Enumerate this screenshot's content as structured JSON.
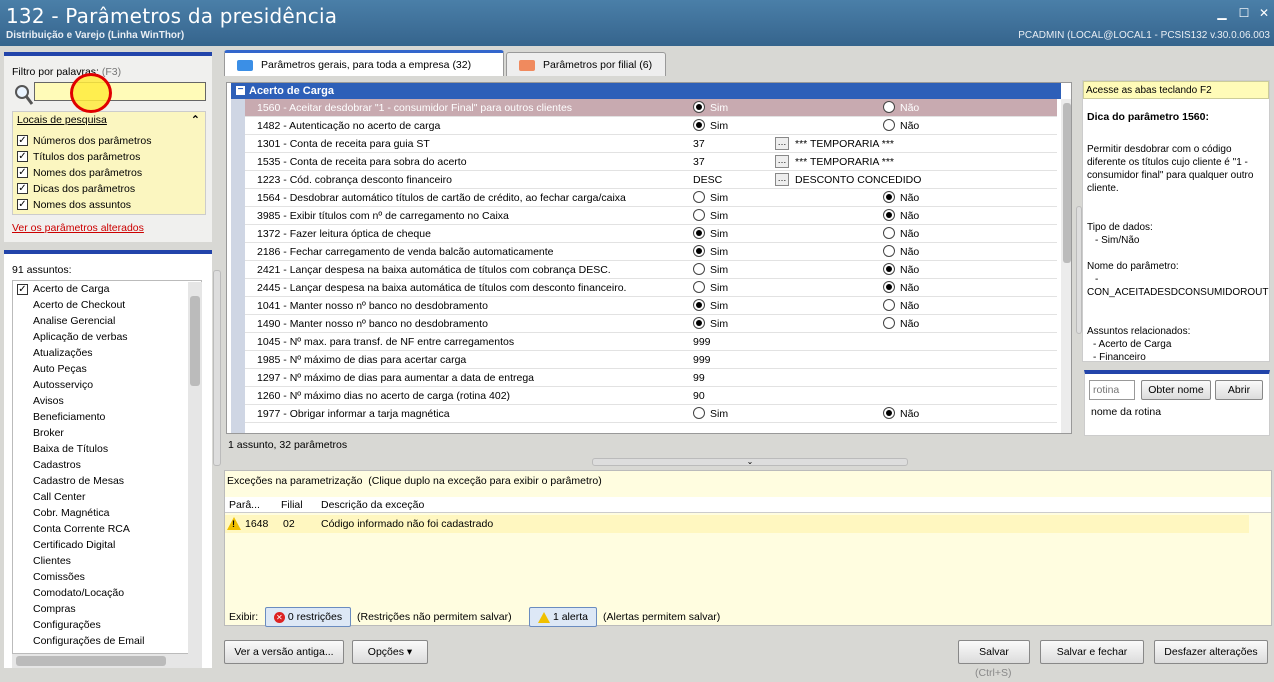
{
  "window": {
    "title": "132 - Parâmetros da presidência",
    "subtitle": "Distribuição e Varejo (Linha WinThor)",
    "user_info": "PCADMIN (LOCAL@LOCAL1 - PCSIS132 v.30.0.06.003"
  },
  "filter": {
    "label": "Filtro por palavras:",
    "shortcut": "(F3)",
    "value": "",
    "locais_title": "Locais de pesquisa",
    "options": [
      {
        "label": "Números dos parâmetros",
        "checked": true
      },
      {
        "label": "Títulos dos parâmetros",
        "checked": true
      },
      {
        "label": "Nomes dos parâmetros",
        "checked": true
      },
      {
        "label": "Dicas dos parâmetros",
        "checked": true
      },
      {
        "label": "Nomes dos assuntos",
        "checked": true
      }
    ],
    "link_alterados": "Ver os parâmetros alterados"
  },
  "subjects": {
    "count_label": "91 assuntos:",
    "items": [
      "Acerto de Carga",
      "Acerto de Checkout",
      "Analise Gerencial",
      "Aplicação de verbas",
      "Atualizações",
      "Auto Peças",
      "Autosserviço",
      "Avisos",
      "Beneficiamento",
      "Broker",
      "Baixa de Títulos",
      "Cadastros",
      "Cadastro de Mesas",
      "Call Center",
      "Cobr. Magnética",
      "Conta Corrente RCA",
      "Certificado Digital",
      "Clientes",
      "Comissões",
      "Comodato/Locação",
      "Compras",
      "Configurações",
      "Configurações de Email"
    ]
  },
  "tabs": [
    {
      "label": "Parâmetros gerais, para toda a empresa",
      "count": "(32)",
      "active": true
    },
    {
      "label": "Parâmetros por filial",
      "count": "(6)",
      "active": false
    }
  ],
  "grid": {
    "group": "Acerto de Carga",
    "rows": [
      {
        "text": "1560 - Aceitar desdobrar \"1 - consumidor Final\" para outros clientes",
        "type": "radio",
        "value": "Sim",
        "sel": true
      },
      {
        "text": "1482 - Autenticação no acerto de carga",
        "type": "radio",
        "value": "Sim"
      },
      {
        "text": "1301 - Conta de receita para guia ST",
        "type": "lookup",
        "code": "37",
        "desc": "*** TEMPORARIA ***"
      },
      {
        "text": "1535 - Conta de receita para sobra do acerto",
        "type": "lookup",
        "code": "37",
        "desc": "*** TEMPORARIA ***"
      },
      {
        "text": "1223 - Cód. cobrança desconto financeiro",
        "type": "lookup",
        "code": "DESC",
        "desc": "DESCONTO CONCEDIDO"
      },
      {
        "text": "1564 - Desdobrar automático títulos de cartão de crédito, ao fechar carga/caixa",
        "type": "radio",
        "value": "Não"
      },
      {
        "text": "3985 - Exibir títulos com nº de carregamento no Caixa",
        "type": "radio",
        "value": "Não"
      },
      {
        "text": "1372 - Fazer leitura óptica de cheque",
        "type": "radio",
        "value": "Sim"
      },
      {
        "text": "2186 - Fechar carregamento de venda balcão automaticamente",
        "type": "radio",
        "value": "Sim"
      },
      {
        "text": "2421 - Lançar despesa na baixa automática de títulos com cobrança DESC.",
        "type": "radio",
        "value": "Não"
      },
      {
        "text": "2445 - Lançar despesa na baixa automática de títulos com desconto financeiro.",
        "type": "radio",
        "value": "Não"
      },
      {
        "text": "1041 - Manter nosso nº banco no desdobramento",
        "type": "radio",
        "value": "Sim"
      },
      {
        "text": "1490 - Manter nosso nº banco no desdobramento",
        "type": "radio",
        "value": "Sim"
      },
      {
        "text": "1045 - Nº max. para transf. de NF entre carregamentos",
        "type": "number",
        "code": "999"
      },
      {
        "text": "1985 - Nº máximo de dias para acertar carga",
        "type": "number",
        "code": "999"
      },
      {
        "text": "1297 - Nº máximo de dias para aumentar a data de entrega",
        "type": "number",
        "code": "99"
      },
      {
        "text": "1260 - Nº máximo dias no acerto de carga (rotina 402)",
        "type": "number",
        "code": "90"
      },
      {
        "text": "1977 - Obrigar informar a tarja magnética",
        "type": "radio",
        "value": "Não"
      }
    ],
    "yes_label": "Sim",
    "no_label": "Não",
    "status": "1 assunto, 32 parâmetros"
  },
  "help": {
    "hint": "Acesse as abas teclando F2",
    "title": "Dica do parâmetro 1560:",
    "body": "Permitir desdobrar com o código diferente os títulos cujo cliente é \"1 - consumidor final\" para qualquer outro cliente.",
    "type_label": "Tipo de dados:",
    "type_value": "- Sim/Não",
    "name_label": "Nome do parâmetro:",
    "name_dash": "-",
    "name_value": "CON_ACEITADESDCONSUMIDOROUT",
    "related_label": "Assuntos relacionados:",
    "related": [
      "- Acerto de Carga",
      "- Financeiro"
    ]
  },
  "rotina": {
    "placeholder": "rotina",
    "get_name": "Obter nome",
    "open": "Abrir",
    "name_label": "nome da rotina"
  },
  "exceptions": {
    "title": "Exceções na parametrização",
    "hint": "(Clique duplo na exceção para exibir o parâmetro)",
    "columns": [
      "Parâ...",
      "Filial",
      "Descrição da exceção"
    ],
    "rows": [
      {
        "param": "1648",
        "filial": "02",
        "desc": "Código informado não foi cadastrado"
      }
    ]
  },
  "footer": {
    "exibir": "Exibir:",
    "restricoes": "0 restrições",
    "restricoes_note": "(Restrições não permitem salvar)",
    "alertas": "1 alerta",
    "alertas_note": "(Alertas permitem salvar)",
    "old_version": "Ver a versão antiga...",
    "options": "Opções",
    "save": "Salvar",
    "save_shortcut": "(Ctrl+S)",
    "save_close": "Salvar e fechar",
    "undo": "Desfazer alterações"
  }
}
